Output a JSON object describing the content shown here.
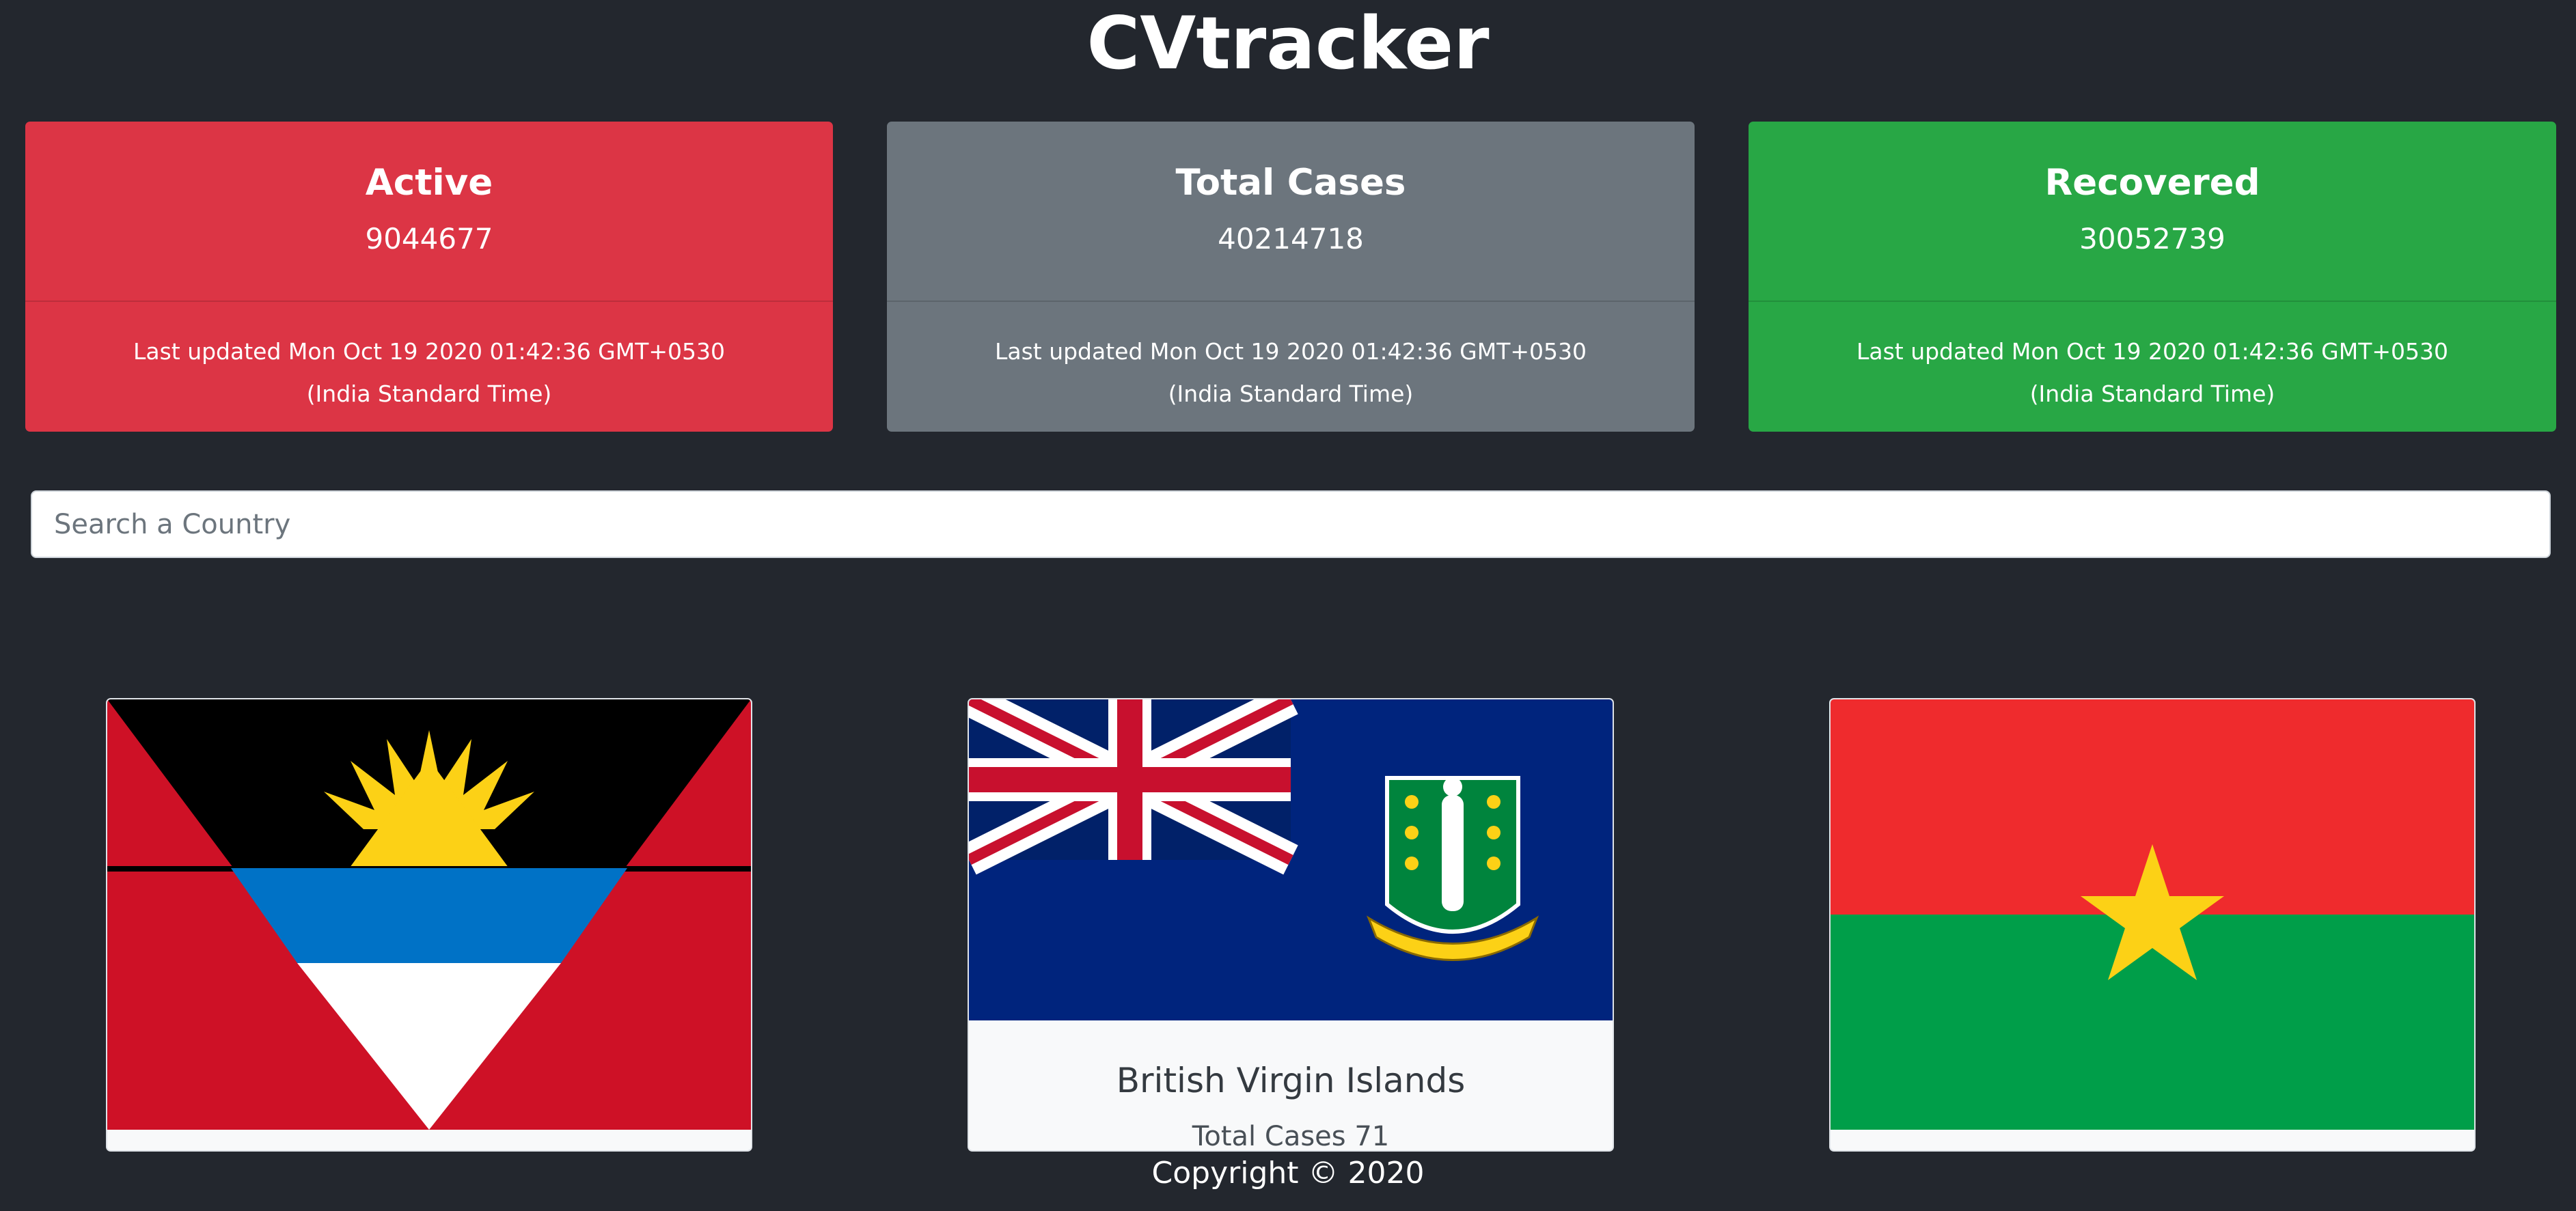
{
  "header": {
    "title": "CVtracker"
  },
  "stats": {
    "active": {
      "label": "Active",
      "value": "9044677",
      "updated": "Last updated Mon Oct 19 2020 01:42:36 GMT+0530 (India Standard Time)",
      "color": "#dc3545"
    },
    "total": {
      "label": "Total Cases",
      "value": "40214718",
      "updated": "Last updated Mon Oct 19 2020 01:42:36 GMT+0530 (India Standard Time)",
      "color": "#6c757d"
    },
    "recovered": {
      "label": "Recovered",
      "value": "30052739",
      "updated": "Last updated Mon Oct 19 2020 01:42:36 GMT+0530 (India Standard Time)",
      "color": "#28a745"
    }
  },
  "search": {
    "placeholder": "Search a Country",
    "value": ""
  },
  "countries": [
    {
      "flag": "antigua-and-barbuda-flag"
    },
    {
      "flag": "british-virgin-islands-flag",
      "name": "British Virgin Islands",
      "cases": "Total Cases 71"
    },
    {
      "flag": "burkina-faso-flag"
    }
  ],
  "footer": {
    "copyright": "Copyright © 2020"
  }
}
